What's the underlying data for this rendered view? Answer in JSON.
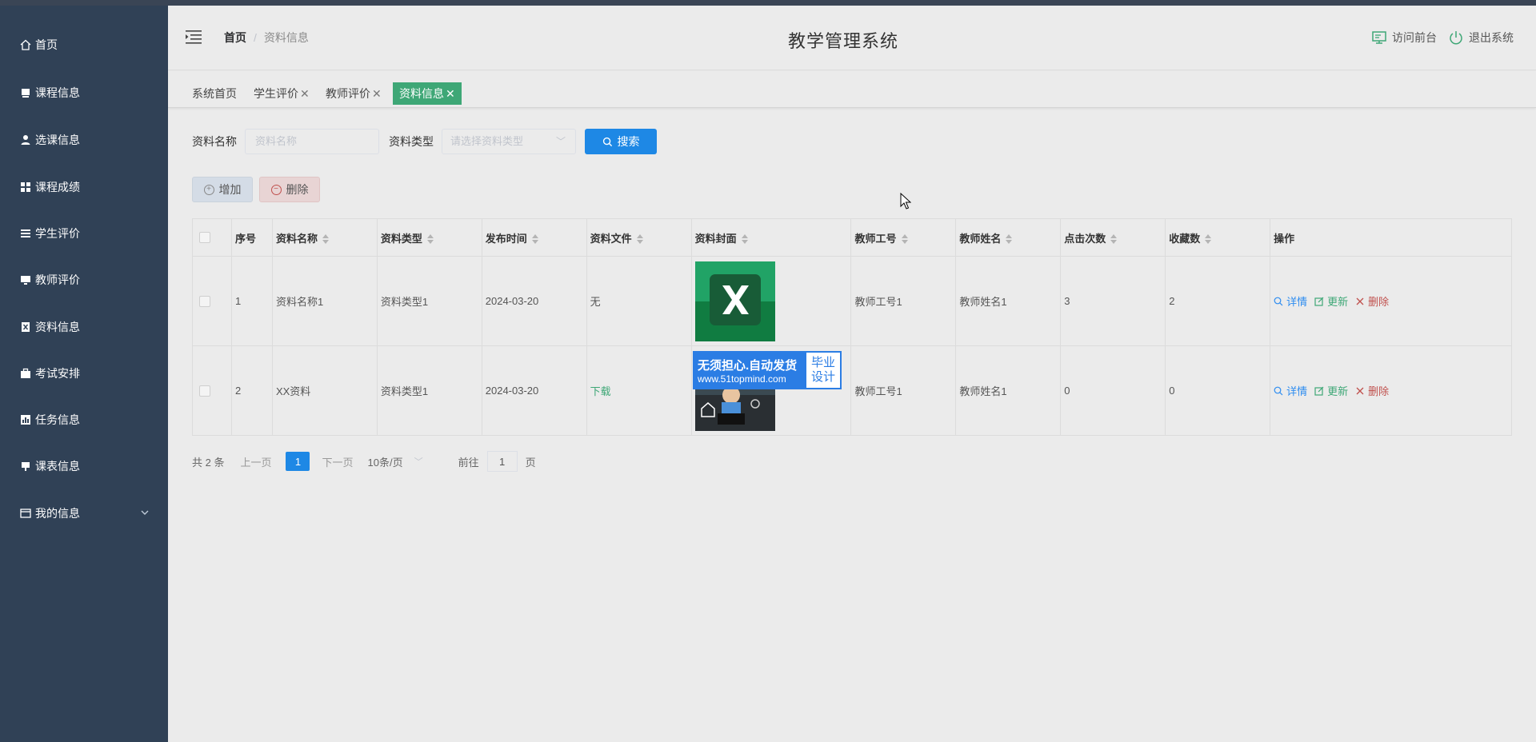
{
  "sidebar": {
    "items": [
      {
        "label": "首页",
        "icon": "home-icon"
      },
      {
        "label": "课程信息",
        "icon": "course-icon"
      },
      {
        "label": "选课信息",
        "icon": "user-icon"
      },
      {
        "label": "课程成绩",
        "icon": "grid-icon"
      },
      {
        "label": "学生评价",
        "icon": "list-icon"
      },
      {
        "label": "教师评价",
        "icon": "monitor-icon"
      },
      {
        "label": "资料信息",
        "icon": "document-icon"
      },
      {
        "label": "考试安排",
        "icon": "briefcase-icon"
      },
      {
        "label": "任务信息",
        "icon": "chart-icon"
      },
      {
        "label": "课表信息",
        "icon": "schedule-icon"
      },
      {
        "label": "我的信息",
        "icon": "card-icon"
      }
    ]
  },
  "header": {
    "breadcrumb_home": "首页",
    "breadcrumb_sep": "/",
    "breadcrumb_current": "资料信息",
    "title": "教学管理系统",
    "frontend_link": "访问前台",
    "logout_link": "退出系统"
  },
  "tabs": [
    {
      "label": "系统首页",
      "closable": false
    },
    {
      "label": "学生评价",
      "closable": true
    },
    {
      "label": "教师评价",
      "closable": true
    },
    {
      "label": "资料信息",
      "closable": true,
      "active": true
    }
  ],
  "search": {
    "name_label": "资料名称",
    "name_placeholder": "资料名称",
    "type_label": "资料类型",
    "type_placeholder": "请选择资料类型",
    "search_button": "搜索"
  },
  "actions": {
    "add": "增加",
    "delete": "删除"
  },
  "table": {
    "headers": [
      "序号",
      "资料名称",
      "资料类型",
      "发布时间",
      "资料文件",
      "资料封面",
      "教师工号",
      "教师姓名",
      "点击次数",
      "收藏数",
      "操作"
    ],
    "rows": [
      {
        "index": "1",
        "name": "资料名称1",
        "type": "资料类型1",
        "date": "2024-03-20",
        "file": "无",
        "cover": "excel-cover",
        "teacher_id": "教师工号1",
        "teacher_name": "教师姓名1",
        "clicks": "3",
        "favorites": "2"
      },
      {
        "index": "2",
        "name": "XX资料",
        "type": "资料类型1",
        "date": "2024-03-20",
        "file": "下载",
        "cover": "classroom-cover",
        "teacher_id": "教师工号1",
        "teacher_name": "教师姓名1",
        "clicks": "0",
        "favorites": "0"
      }
    ],
    "op_detail": "详情",
    "op_update": "更新",
    "op_delete": "删除"
  },
  "pagination": {
    "total": "共 2 条",
    "prev": "上一页",
    "current": "1",
    "next": "下一页",
    "page_size": "10条/页",
    "goto_label": "前往",
    "goto_value": "1",
    "goto_suffix": "页"
  },
  "watermark": {
    "line1": "无须担心.自动发货",
    "line2": "www.51topmind.com",
    "right_top": "毕业",
    "right_bottom": "设计"
  },
  "colors": {
    "sidebar_bg": "#304156",
    "accent_blue": "#1e88e5",
    "active_tab": "#3ea776",
    "delete_red": "#c0504d"
  }
}
